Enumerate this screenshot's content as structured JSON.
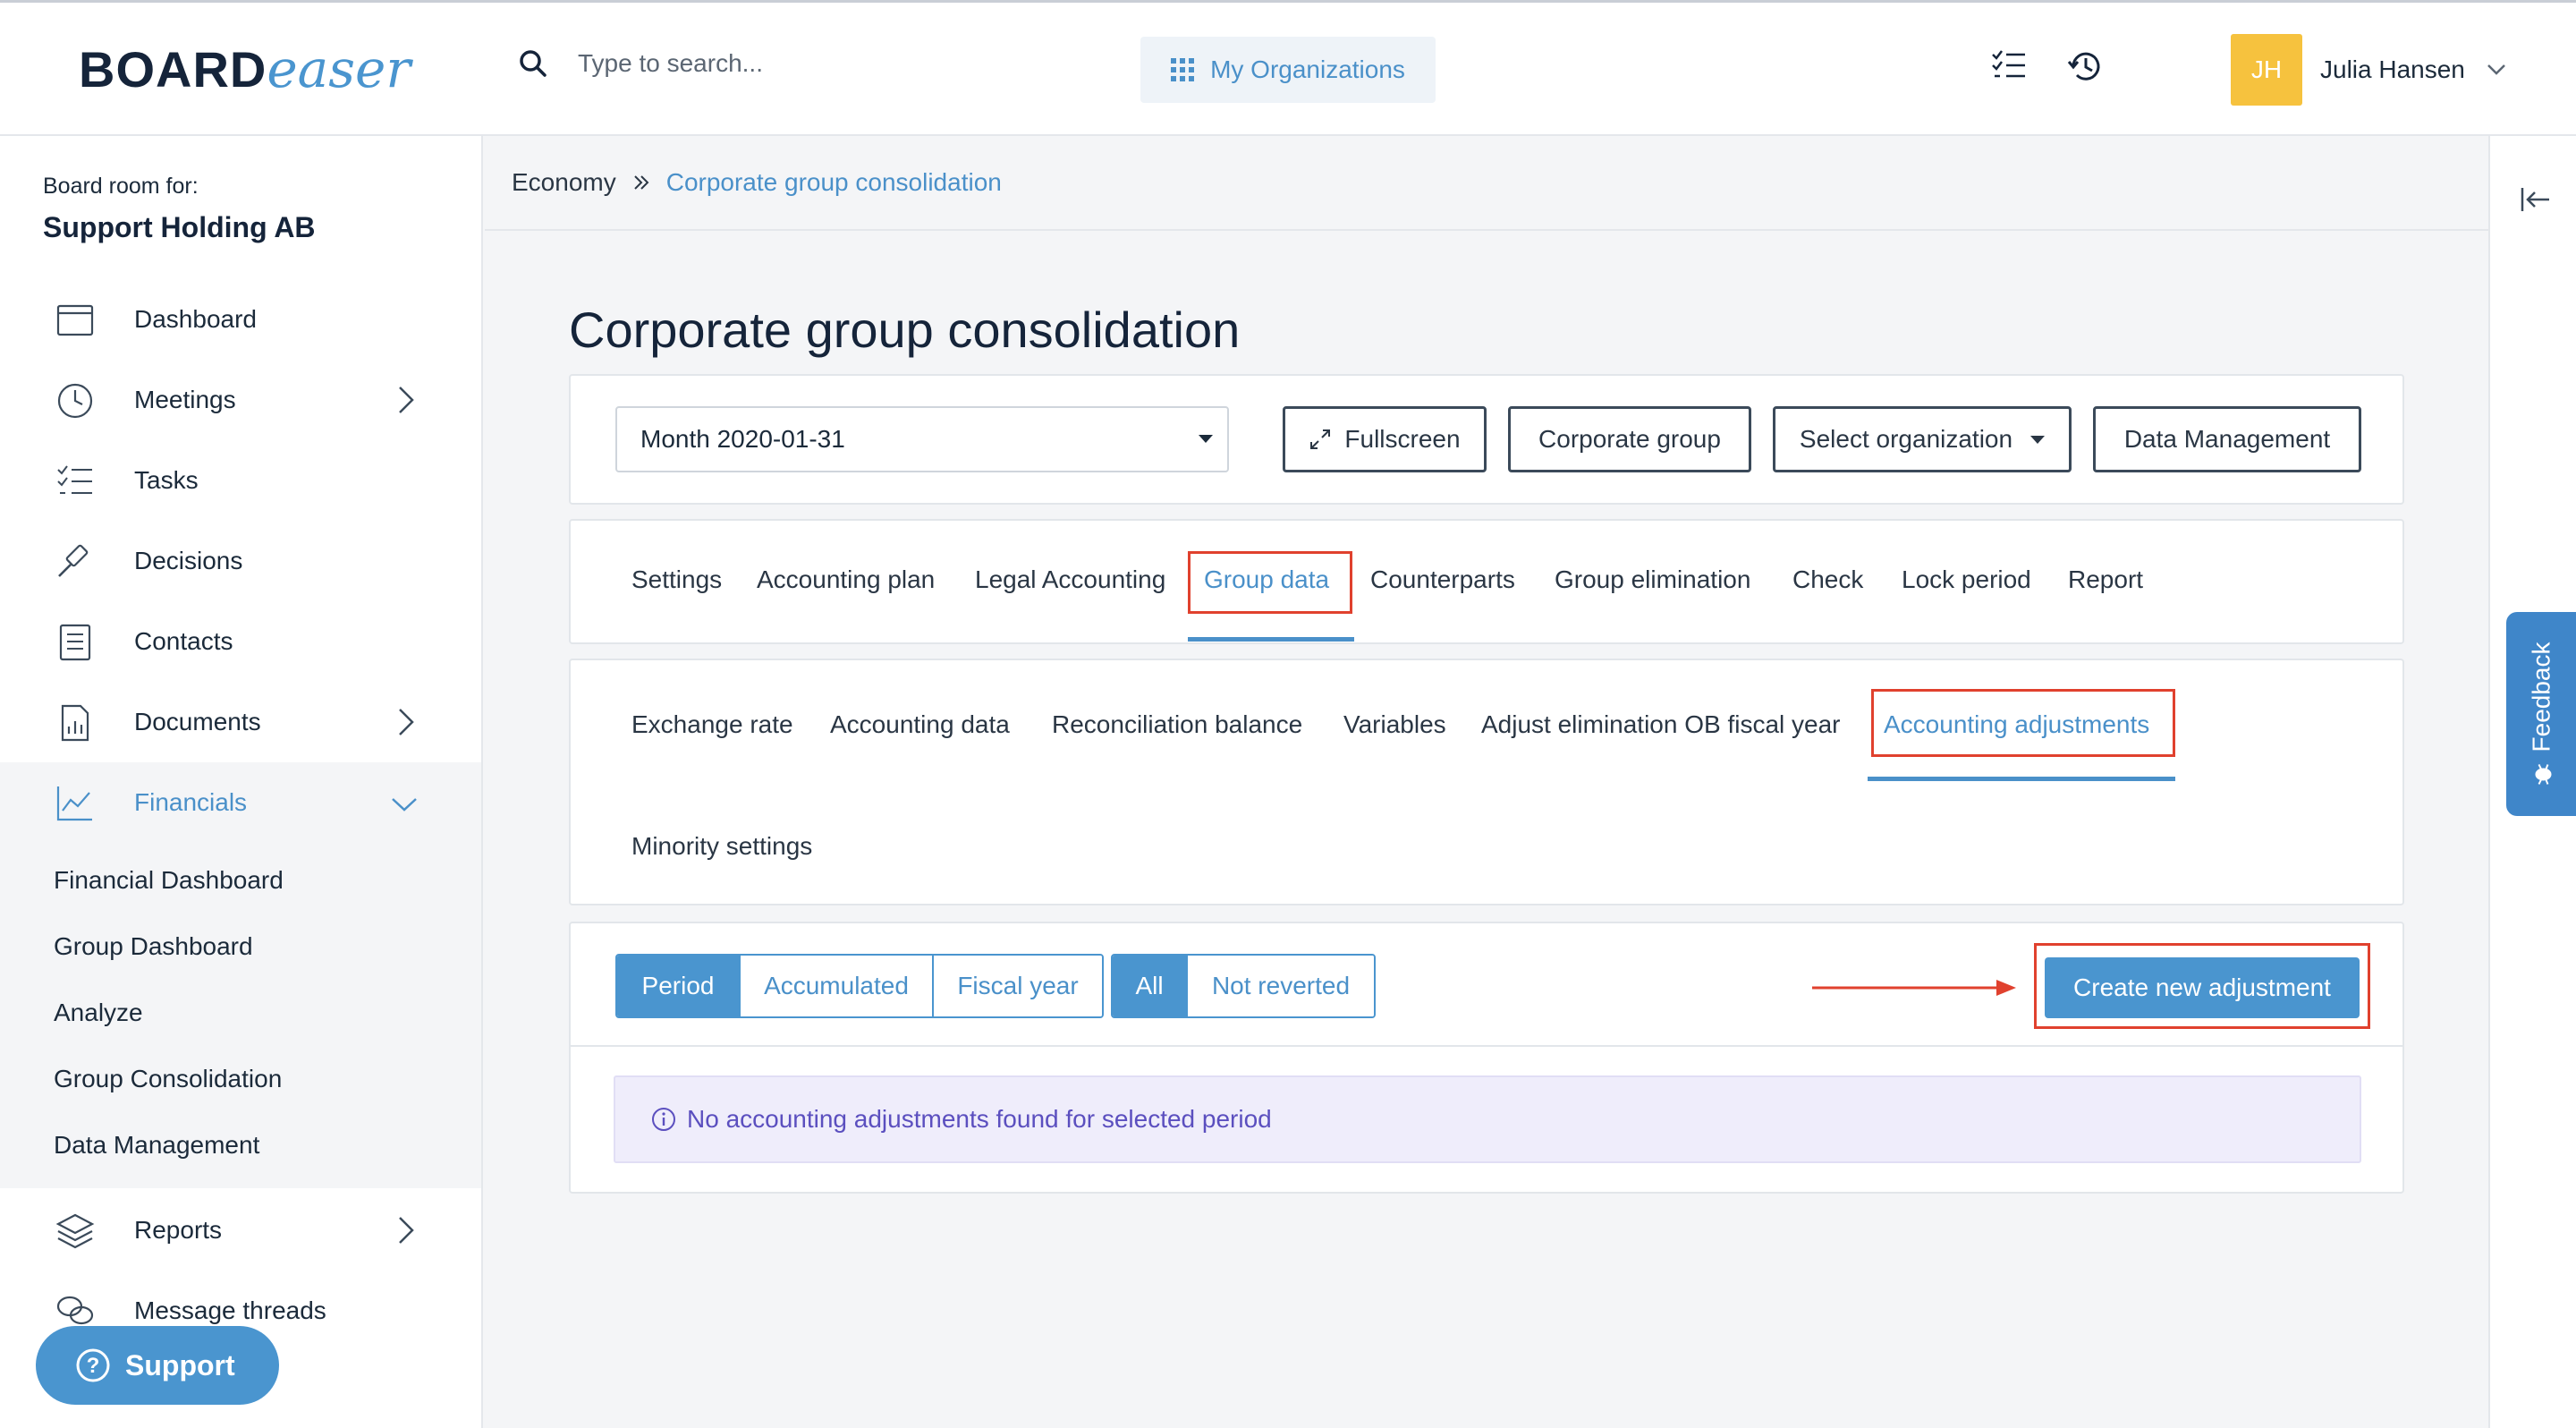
{
  "header": {
    "logo_bold": "BOARD",
    "logo_script": "easer",
    "search_placeholder": "Type to search...",
    "orgs_button": "My Organizations",
    "user_initials": "JH",
    "user_name": "Julia Hansen"
  },
  "sidebar": {
    "board_label": "Board room for:",
    "board_name": "Support Holding AB",
    "items": [
      {
        "label": "Dashboard",
        "icon": "calendar-icon"
      },
      {
        "label": "Meetings",
        "icon": "clock-icon"
      },
      {
        "label": "Tasks",
        "icon": "checklist-icon"
      },
      {
        "label": "Decisions",
        "icon": "gavel-icon"
      },
      {
        "label": "Contacts",
        "icon": "address-book-icon"
      },
      {
        "label": "Documents",
        "icon": "document-chart-icon"
      },
      {
        "label": "Financials",
        "icon": "line-chart-icon"
      },
      {
        "label": "Reports",
        "icon": "layers-icon"
      },
      {
        "label": "Message threads",
        "icon": "chat-bubbles-icon"
      }
    ],
    "financials_sub": [
      "Financial Dashboard",
      "Group Dashboard",
      "Analyze",
      "Group Consolidation",
      "Data Management"
    ],
    "support_label": "Support"
  },
  "breadcrumb": {
    "root": "Economy",
    "current": "Corporate group consolidation"
  },
  "page_title": "Corporate group consolidation",
  "toolbar": {
    "period_select": "Month 2020-01-31",
    "fullscreen": "Fullscreen",
    "corporate_group": "Corporate group",
    "select_organization": "Select organization",
    "data_management": "Data Management"
  },
  "main_tabs": [
    "Settings",
    "Accounting plan",
    "Legal Accounting",
    "Group data",
    "Counterparts",
    "Group elimination",
    "Check",
    "Lock period",
    "Report"
  ],
  "main_tabs_active": "Group data",
  "sub_tabs": [
    "Exchange rate",
    "Accounting data",
    "Reconciliation balance",
    "Variables",
    "Adjust elimination OB fiscal year",
    "Accounting adjustments",
    "Minority settings"
  ],
  "sub_tabs_active": "Accounting adjustments",
  "filters": {
    "range": [
      "Period",
      "Accumulated",
      "Fiscal year"
    ],
    "range_active": "Period",
    "status": [
      "All",
      "Not reverted"
    ],
    "status_active": "All"
  },
  "create_button": "Create new adjustment",
  "empty_message": "No accounting adjustments found for selected period",
  "feedback_label": "Feedback",
  "colors": {
    "accent": "#4a95cf",
    "highlight": "#e0412e",
    "avatar": "#f6c23e",
    "info_text": "#5b4fbf"
  }
}
